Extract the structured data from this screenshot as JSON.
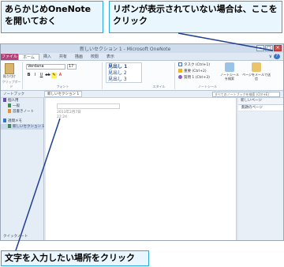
{
  "callouts": {
    "open_onenote": "あらかじめOneNoteを開いておく",
    "ribbon_hidden": "リボンが表示されていない場合は、ここをクリック",
    "click_place": "文字を入力したい場所をクリック"
  },
  "window": {
    "title": "新しいセクション 1 - Microsoft OneNote",
    "min": "–",
    "max": "□",
    "close": "×",
    "help": "?",
    "expand": "∨"
  },
  "tabs": [
    "ファイル",
    "ホーム",
    "挿入",
    "共有",
    "描画",
    "校閲",
    "表示"
  ],
  "ribbon": {
    "paste": "貼り付け",
    "font_name": "Verdana",
    "font_size": "17",
    "style_h1": "見出し 1",
    "style_h2": "見出し 2",
    "style_h3": "見出し 3",
    "tag1": "タスク (Ctrl+1)",
    "tag2": "重要 (Ctrl+2)",
    "tag3": "質問 1 (Ctrl+3)",
    "tag_btn": "ノートシールを検索",
    "outlook_btn": "ページをメールで送信",
    "groups": [
      "クリップボード",
      "フォント",
      "スタイル",
      "ノートシール"
    ]
  },
  "subbar": {
    "notebook_label": "ノートブック",
    "section_tab": "新しいセクション 1",
    "search_placeholder": "すべてのノートブックを検索 (Ctrl+E)"
  },
  "nav": {
    "items": [
      {
        "label": "個人用"
      },
      {
        "label": "一般"
      },
      {
        "label": "首書きノート"
      },
      {
        "label": "週間メモ"
      },
      {
        "label": "新しいセクション 1"
      }
    ],
    "bottom": "クイックノート"
  },
  "page": {
    "date": "2013年2月7日",
    "time": "22:24"
  },
  "pagelist": {
    "header": "新しいページ",
    "item": "無題のページ"
  }
}
